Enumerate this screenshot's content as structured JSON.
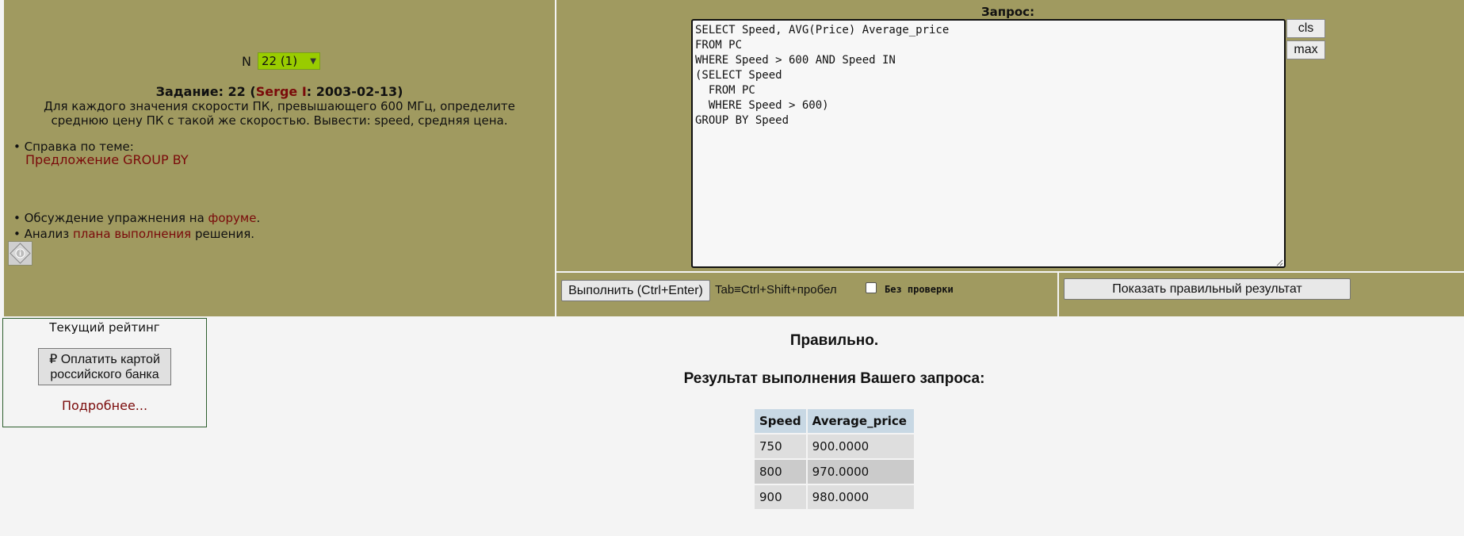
{
  "task": {
    "n_label": "N",
    "n_value": "22 (1)",
    "title_prefix": "Задание: 22 (",
    "author": "Serge I",
    "title_suffix": ": 2003-02-13)",
    "description": "Для каждого значения скорости ПК, превышающего 600 МГц, определите среднюю цену ПК с такой же скоростью. Вывести: speed, средняя цена."
  },
  "help": {
    "topic_label": "• Справка по теме:",
    "topic_link": "Предложение GROUP BY",
    "discussion_prefix": "• Обсуждение упражнения на ",
    "discussion_link": "форуме",
    "discussion_suffix": ".",
    "analysis_prefix": "• Анализ ",
    "analysis_link": "плана выполнения",
    "analysis_suffix": " решения."
  },
  "query": {
    "label": "Запрос:",
    "text": "SELECT Speed, AVG(Price) Average_price\nFROM PC\nWHERE Speed > 600 AND Speed IN\n(SELECT Speed\n  FROM PC\n  WHERE Speed > 600)\nGROUP BY Speed",
    "cls_label": "cls",
    "max_label": "max"
  },
  "toolbar": {
    "run_label": "Выполнить (Ctrl+Enter)",
    "tab_hint": "Tab≡Ctrl+Shift+пробел",
    "no_check_label": "Без проверки",
    "show_result_label": "Показать правильный результат"
  },
  "rating": {
    "title": "Текущий рейтинг",
    "pay_line1": "₽ Оплатить картой",
    "pay_line2": "российского банка",
    "more_link": "Подробнее..."
  },
  "result": {
    "status": "Правильно.",
    "title": "Результат выполнения Вашего запроса:",
    "columns": [
      "Speed",
      "Average_price"
    ],
    "rows": [
      [
        "750",
        "900.0000"
      ],
      [
        "800",
        "970.0000"
      ],
      [
        "900",
        "980.0000"
      ]
    ]
  }
}
